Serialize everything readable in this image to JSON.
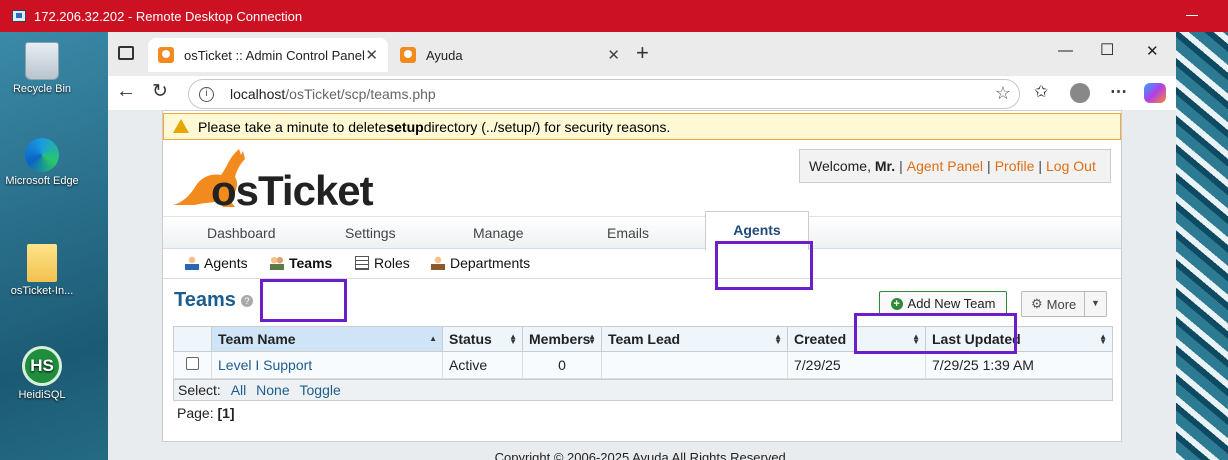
{
  "rdp": {
    "title": "172.206.32.202 - Remote Desktop Connection"
  },
  "desktop": {
    "icons": [
      {
        "label": "Recycle Bin",
        "icon": "recycle-bin-icon"
      },
      {
        "label": "Microsoft Edge",
        "icon": "edge-icon"
      },
      {
        "label": "osTicket-In...",
        "icon": "folder-icon"
      },
      {
        "label": "HeidiSQL",
        "icon": "heidisql-icon",
        "glyph": "HS"
      }
    ]
  },
  "browser": {
    "tabs": [
      {
        "label": "osTicket :: Admin Control Panel",
        "active": true
      },
      {
        "label": "Ayuda",
        "active": false
      }
    ],
    "new_tab": "+",
    "url_host": "localhost",
    "url_path": "/osTicket/scp/teams.php"
  },
  "page": {
    "warning": {
      "pre": "Please take a minute to delete ",
      "bold": "setup",
      "post": " directory (../setup/) for security reasons."
    },
    "logo_text": "osTicket",
    "welcome": {
      "pre": "Welcome, ",
      "name": "Mr.",
      "agent_panel": "Agent Panel",
      "profile": "Profile",
      "logout": "Log Out",
      "sep": "|"
    },
    "nav": {
      "dashboard": "Dashboard",
      "settings": "Settings",
      "manage": "Manage",
      "emails": "Emails",
      "agents": "Agents"
    },
    "subnav": {
      "agents": "Agents",
      "teams": "Teams",
      "roles": "Roles",
      "departments": "Departments"
    },
    "title": "Teams",
    "help": "?",
    "add_button": "Add New Team",
    "more_button": "More",
    "table": {
      "headers": [
        "Team Name",
        "Status",
        "Members",
        "Team Lead",
        "Created",
        "Last Updated"
      ],
      "rows": [
        {
          "name": "Level I Support",
          "status": "Active",
          "members": "0",
          "lead": "",
          "created": "7/29/25",
          "updated": "7/29/25 1:39 AM"
        }
      ]
    },
    "select": {
      "label": "Select:",
      "all": "All",
      "none": "None",
      "toggle": "Toggle"
    },
    "pager": {
      "label": "Page:",
      "current": "[1]"
    },
    "footer": "Copyright © 2006-2025 Ayuda All Rights Reserved."
  },
  "colors": {
    "rdp_bar": "#cc1222",
    "highlight": "#6a1fc9",
    "brand_orange": "#f28a1e",
    "link": "#1d5d8e"
  }
}
